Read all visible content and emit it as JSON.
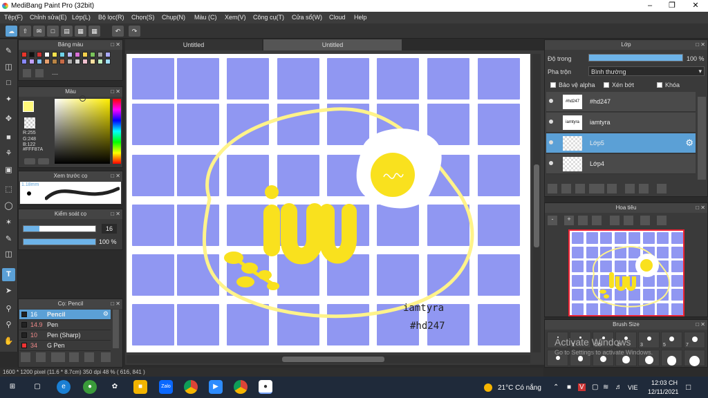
{
  "app": {
    "title": "MediBang Paint Pro (32bit)"
  },
  "menu": [
    "Tệp(F)",
    "Chỉnh sửa(E)",
    "Lớp(L)",
    "Bộ lọc(R)",
    "Chọn(S)",
    "Chụp(N)",
    "Màu (C)",
    "Xem(V)",
    "Công cụ(T)",
    "Cửa sổ(W)",
    "Cloud",
    "Help"
  ],
  "tabs": [
    "Untitled",
    "Untitled"
  ],
  "palette_panel": {
    "title": "Bảng màu",
    "placeholder": "---",
    "colors": [
      "#e8352a",
      "#111111",
      "#cc3333",
      "#ffffff",
      "#f4e04c",
      "#6ed1e8",
      "#b8b8ff",
      "#d86fd8",
      "#f4d04c",
      "#79c35b",
      "#a0a0a0",
      "#aaaaff",
      "#8888ff",
      "#c0a0ff",
      "#80c0ff",
      "#e7a06e",
      "#b88444",
      "#c66a46",
      "#b0b0b0",
      "#d8d8d8",
      "#f0c0d0",
      "#ffe0a0",
      "#c0f0c0",
      "#a0e0ff"
    ]
  },
  "color_panel": {
    "title": "Màu",
    "r": "R:255",
    "g": "G:248",
    "b": "B:122",
    "hex": "#FFF87A",
    "current_color": "#fff87a"
  },
  "brush_preview": {
    "title": "Xem trước cọ",
    "size": "1.18mm"
  },
  "brush_control": {
    "title": "Kiểm soát cọ",
    "size": "16",
    "opacity": "100 %",
    "size_level": 0.22,
    "opacity_level": 1.0
  },
  "brush_list": {
    "title": "Cọ: Pencil",
    "items": [
      {
        "size": "16",
        "name": "Pencil",
        "selected": true
      },
      {
        "size": "14.9",
        "name": "Pen"
      },
      {
        "size": "10",
        "name": "Pen (Sharp)"
      },
      {
        "size": "34",
        "name": "G Pen"
      }
    ]
  },
  "layer_panel": {
    "title": "Lớp",
    "opacity_label": "Độ trong",
    "opacity_value": "100 %",
    "opacity_level": 1.0,
    "blend_label": "Pha trộn",
    "blend_value": "Bình thường",
    "protect_alpha": "Bảo vệ alpha",
    "clipping": "Xén bớt",
    "lock": "Khóa",
    "layers": [
      {
        "name": "#hd247",
        "thumb_text": "#hd247"
      },
      {
        "name": "iamtyra",
        "thumb_text": "iamtyra"
      },
      {
        "name": "Lớp5",
        "selected": true
      },
      {
        "name": "Lớp4"
      }
    ]
  },
  "navigator": {
    "title": "Hoa tiêu"
  },
  "brush_size": {
    "title": "Brush Size",
    "labels": [
      "1",
      "1.5",
      "2",
      "3",
      "5",
      "7"
    ]
  },
  "watermark": {
    "line1": "Activate Windows",
    "line2": "Go to Settings to activate Windows."
  },
  "canvas_text": {
    "line1": "iamtyra",
    "line2": "#hd247",
    "big": "iu"
  },
  "status": "1600 * 1200 pixel  (11.6 * 8.7cm)  350 dpi  48 %  ( 616, 841 )",
  "taskbar": {
    "weather": "21°C  Có nắng",
    "lang": "VIE",
    "time": "12:03 CH",
    "date": "12/11/2021"
  },
  "colors": {
    "accent": "#5ba0d6",
    "canvas_cell": "#9097f2",
    "yellow": "#f9e11e",
    "outline": "#fff38a"
  }
}
